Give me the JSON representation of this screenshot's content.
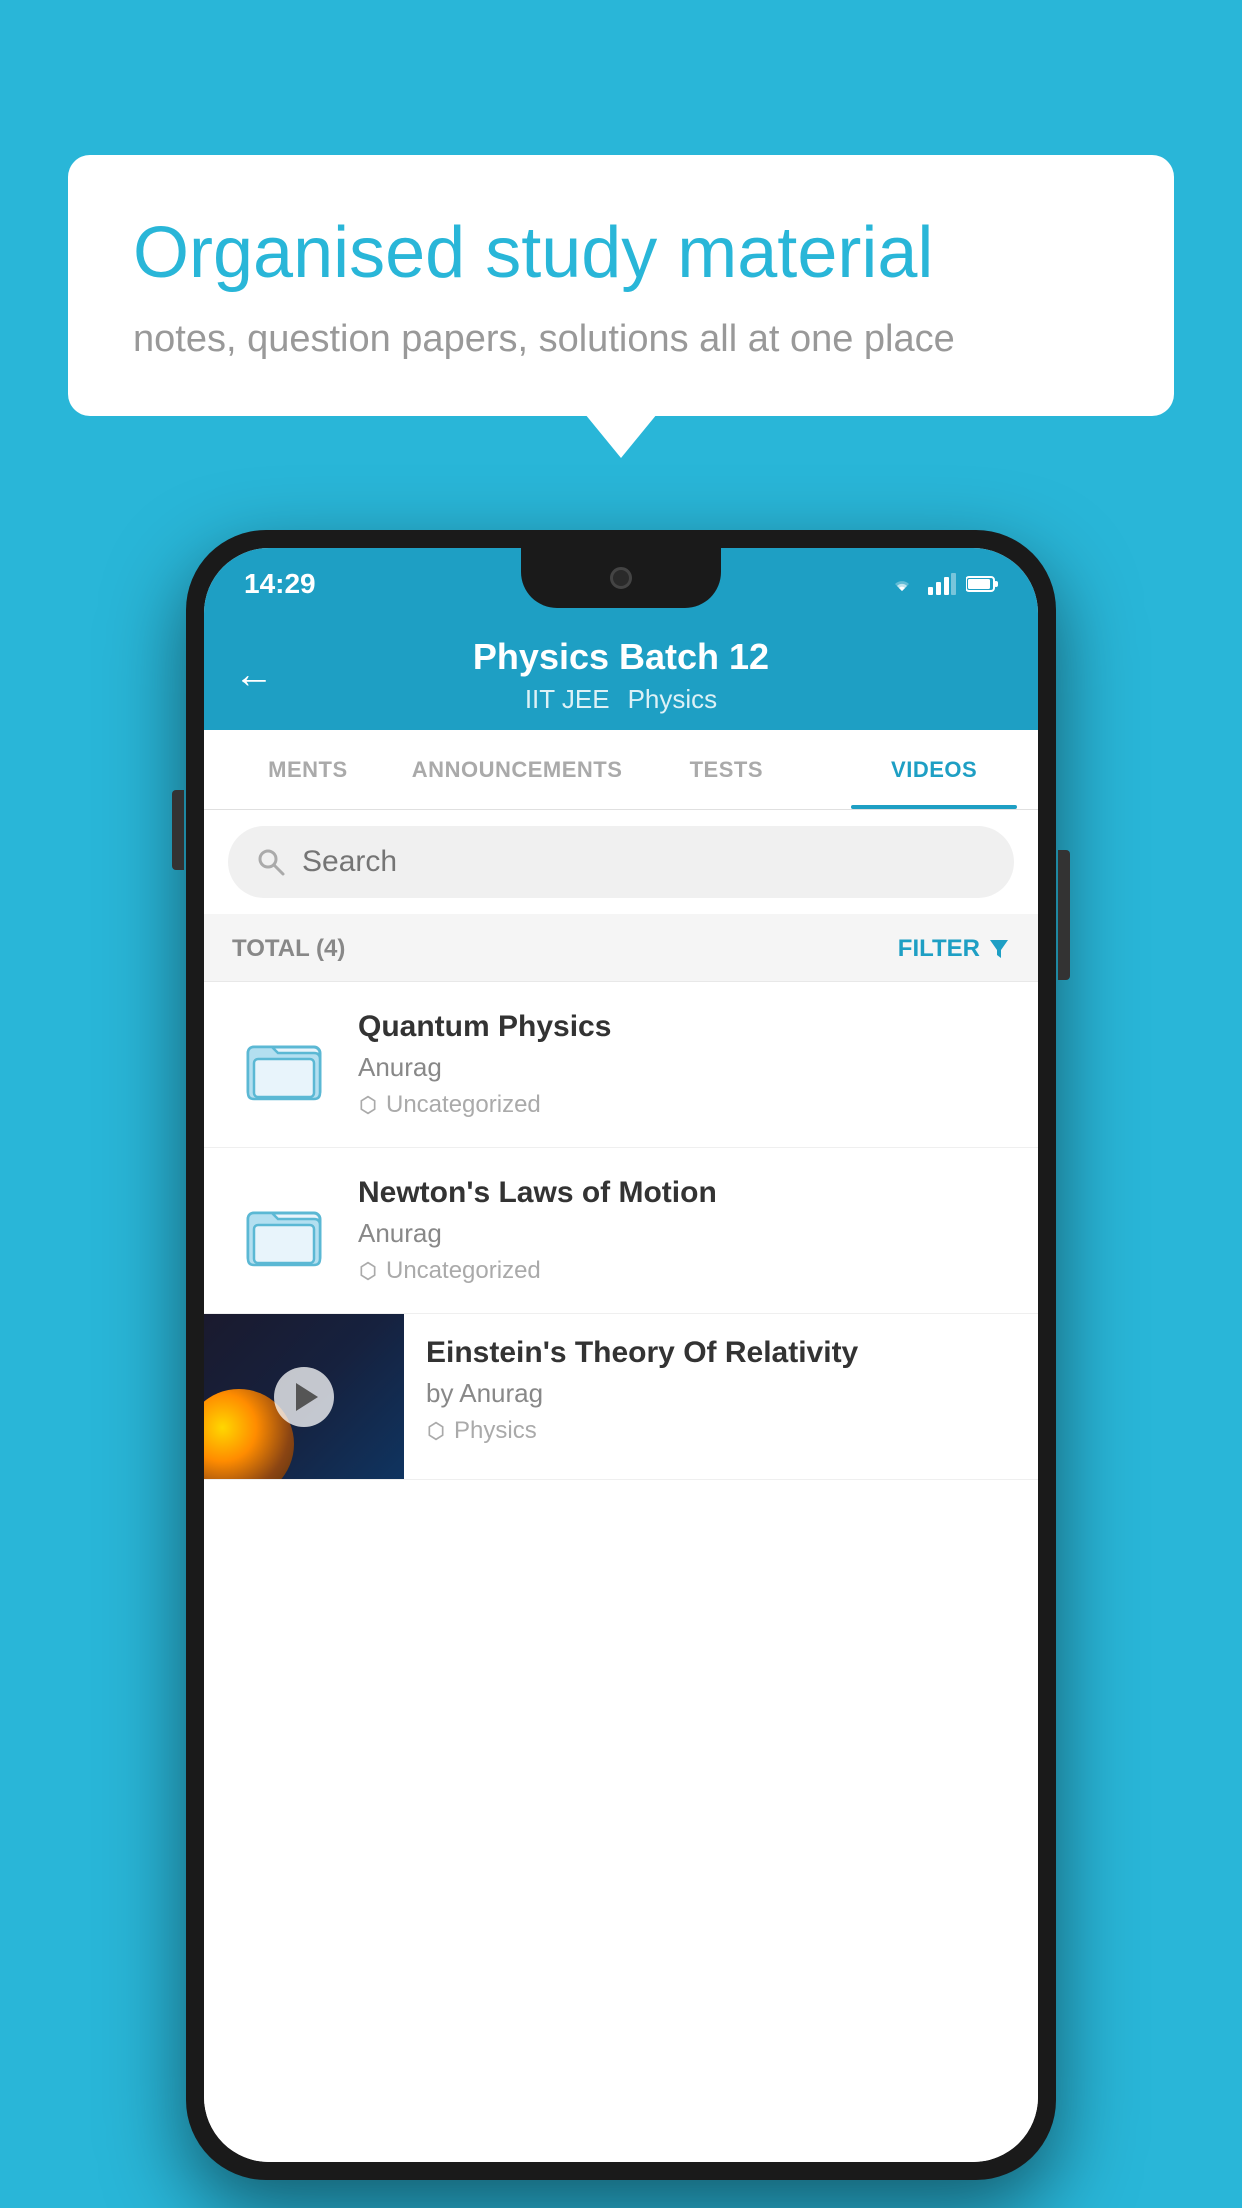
{
  "background_color": "#29b6d8",
  "speech_bubble": {
    "heading": "Organised study material",
    "subtext": "notes, question papers, solutions all at one place"
  },
  "status_bar": {
    "time": "14:29",
    "icons": [
      "wifi",
      "signal",
      "battery"
    ]
  },
  "nav": {
    "back_label": "←",
    "title": "Physics Batch 12",
    "subtitle_tags": [
      "IIT JEE",
      "Physics"
    ]
  },
  "tabs": [
    {
      "label": "MENTS",
      "active": false
    },
    {
      "label": "ANNOUNCEMENTS",
      "active": false
    },
    {
      "label": "TESTS",
      "active": false
    },
    {
      "label": "VIDEOS",
      "active": true
    }
  ],
  "search": {
    "placeholder": "Search"
  },
  "filter_row": {
    "total_label": "TOTAL (4)",
    "filter_label": "FILTER"
  },
  "videos": [
    {
      "id": 1,
      "type": "folder",
      "title": "Quantum Physics",
      "author": "Anurag",
      "tag": "Uncategorized",
      "has_thumb": false
    },
    {
      "id": 2,
      "type": "folder",
      "title": "Newton's Laws of Motion",
      "author": "Anurag",
      "tag": "Uncategorized",
      "has_thumb": false
    },
    {
      "id": 3,
      "type": "video",
      "title": "Einstein's Theory Of Relativity",
      "author": "by Anurag",
      "tag": "Physics",
      "has_thumb": true
    }
  ]
}
